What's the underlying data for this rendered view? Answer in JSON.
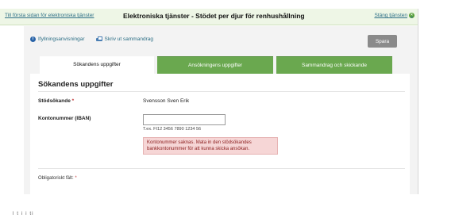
{
  "header": {
    "home_link": "Till första sidan för elektroniska tjänster",
    "title": "Elektroniska tjänster - Stödet per djur för renhushållning",
    "close_link": "Stäng tjänsten"
  },
  "toolbar": {
    "instructions": "Ifyllningsanvisningar",
    "print": "Skriv ut sammandrag",
    "save": "Spara"
  },
  "tabs": [
    {
      "label": "Sökandens uppgifter",
      "active": true
    },
    {
      "label": "Ansökningens uppgifter",
      "active": false
    },
    {
      "label": "Sammandrag och skickande",
      "active": false
    }
  ],
  "form": {
    "heading": "Sökandens uppgifter",
    "applicant_label": "Stödsökande",
    "required_mark": "*",
    "applicant_value": "Svensson Sven Erik",
    "iban_label": "Kontonummer (IBAN)",
    "iban_value": "",
    "iban_hint": "T.ex. FI12 3456 7890 1234 56",
    "error_message": "Kontonummer saknas. Mata in den stödsökandes bankkontonummer för att kunna skicka ansökan.",
    "mandatory_note": "Obligatoriskt fält:"
  },
  "footer": {
    "partial_text": "l t i  i  ti"
  },
  "colors": {
    "tab_green": "#6aa84f",
    "error_bg": "#f6d6d6",
    "link_blue": "#2d6f86",
    "header_bg": "#eef6e6"
  }
}
